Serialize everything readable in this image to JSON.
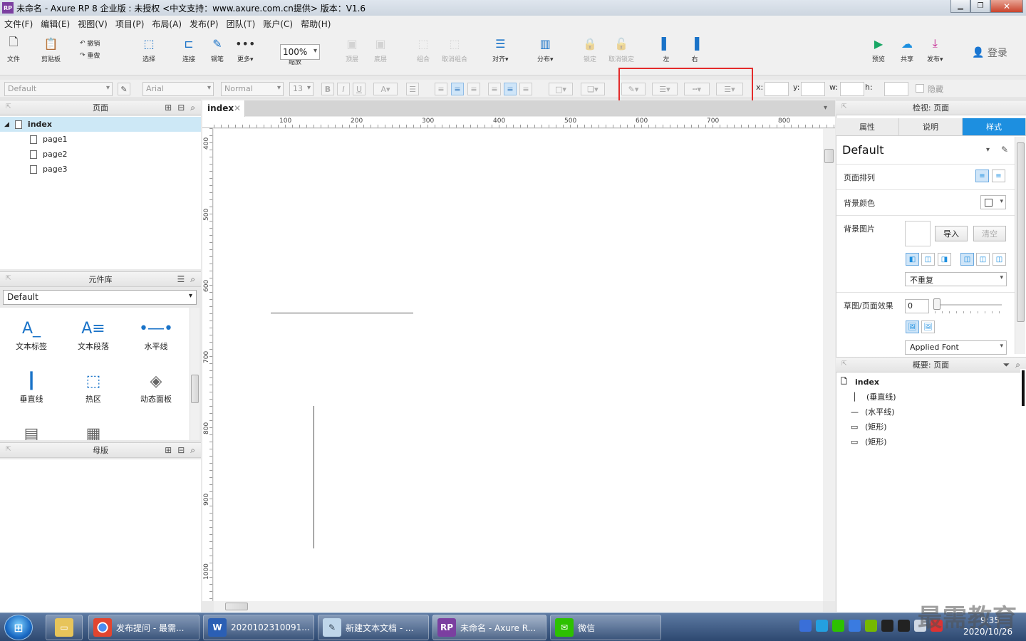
{
  "window": {
    "title": "未命名 - Axure RP 8 企业版 : 未授权      <中文支持：www.axure.com.cn提供> 版本：V1.6",
    "app_icon": "RP"
  },
  "menu": [
    "文件(F)",
    "编辑(E)",
    "视图(V)",
    "项目(P)",
    "布局(A)",
    "发布(P)",
    "团队(T)",
    "账户(C)",
    "帮助(H)"
  ],
  "toolbar": {
    "file": "文件",
    "clipboard": "剪贴板",
    "undo": "撤销",
    "redo": "重做",
    "select": "选择",
    "connect": "连接",
    "pen": "钢笔",
    "more": "更多▾",
    "zoom_value": "100%",
    "zoom_label": "缩放",
    "top": "顶层",
    "bottom": "底层",
    "group": "组合",
    "ungroup": "取消组合",
    "align": "对齐▾",
    "distribute": "分布▾",
    "lock": "锁定",
    "unlock": "取消锁定",
    "left": "左",
    "right": "右",
    "preview": "预览",
    "share": "共享",
    "publish": "发布▾",
    "login": "登录"
  },
  "format": {
    "style_combo": "Default",
    "font_combo": "Arial",
    "weight_combo": "Normal",
    "size_combo": "13",
    "x_label": "x:",
    "y_label": "y:",
    "w_label": "w:",
    "h_label": "h:",
    "hide_label": "隐藏"
  },
  "pages_panel": {
    "title": "页面",
    "pages": [
      "index",
      "page1",
      "page2",
      "page3"
    ]
  },
  "library_panel": {
    "title": "元件库",
    "selected": "Default",
    "widgets": [
      "文本标签",
      "文本段落",
      "水平线",
      "垂直线",
      "热区",
      "动态面板"
    ]
  },
  "masters_panel": {
    "title": "母版"
  },
  "canvas": {
    "tab": "index",
    "hruler": [
      "100",
      "200",
      "300",
      "400",
      "500",
      "600",
      "700",
      "800"
    ],
    "vruler": [
      "400",
      "500",
      "600",
      "700",
      "800",
      "900",
      "1000"
    ]
  },
  "inspector": {
    "title": "检视: 页面",
    "tabs": [
      "属性",
      "说明",
      "样式"
    ],
    "style_name": "Default",
    "page_align_label": "页面排列",
    "bg_color_label": "背景颜色",
    "bg_image_label": "背景图片",
    "import_btn": "导入",
    "clear_btn": "清空",
    "repeat_value": "不重复",
    "sketch_label": "草图/页面效果",
    "sketch_value": "0",
    "font_value": "Applied Font"
  },
  "outline": {
    "title": "概要: 页面",
    "root": "index",
    "items": [
      "(垂直线)",
      "(水平线)",
      "(矩形)",
      "(矩形)"
    ]
  },
  "taskbar": {
    "items": [
      "发布提问 - 最需...",
      "2020102310091...",
      "新建文本文档 - ...",
      "未命名 - Axure R...",
      "微信"
    ],
    "time": "9:35",
    "date": "2020/10/26"
  },
  "watermark": "最需教育",
  "colors": {
    "accent": "#1d8fe0",
    "highlight": "#e32b2b"
  }
}
